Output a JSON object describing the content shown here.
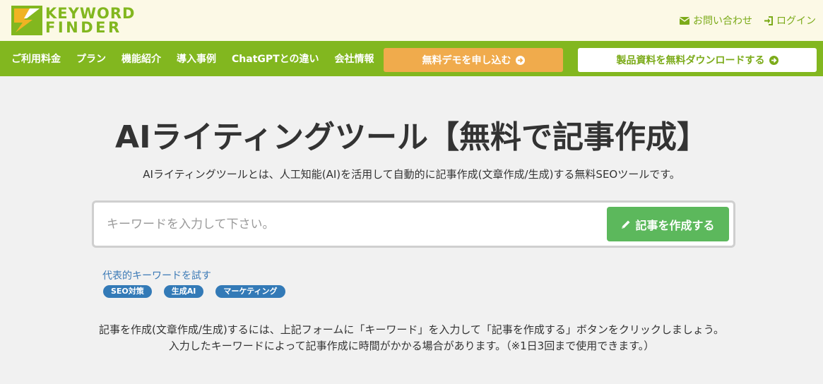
{
  "header": {
    "logo_line1": "KEYWORD",
    "logo_line2": "FINDER",
    "contact_label": "お問い合わせ",
    "login_label": "ログイン"
  },
  "nav": {
    "items": [
      {
        "label": "ご利用料金"
      },
      {
        "label": "プラン"
      },
      {
        "label": "機能紹介"
      },
      {
        "label": "導入事例"
      },
      {
        "label": "ChatGPTとの違い"
      },
      {
        "label": "会社情報"
      }
    ],
    "demo_label": "無料デモを申し込む",
    "download_label": "製品資料を無料ダウンロードする"
  },
  "main": {
    "title": "AIライティングツール【無料で記事作成】",
    "subtitle": "AIライティングツールとは、人工知能(AI)を活用して自動的に記事作成(文章作成/生成)する無料SEOツールです。",
    "search_placeholder": "キーワードを入力して下さい。",
    "search_value": "",
    "create_label": "記事を作成する",
    "try_label": "代表的キーワードを試す",
    "tags": [
      "SEO対策",
      "生成AI",
      "マーケティング"
    ],
    "desc_line1": "記事を作成(文章作成/生成)するには、上記フォームに「キーワード」を入力して「記事を作成する」ボタンをクリックしましょう。",
    "desc_line2": "入力したキーワードによって記事作成に時間がかかる場合があります。（※1日3回まで使用できます。）"
  },
  "colors": {
    "brand_green": "#82b71f",
    "header_bg": "#fcf9e6",
    "demo_orange": "#f0ab4c",
    "create_green": "#5cb85c",
    "tag_blue": "#337ab7"
  }
}
